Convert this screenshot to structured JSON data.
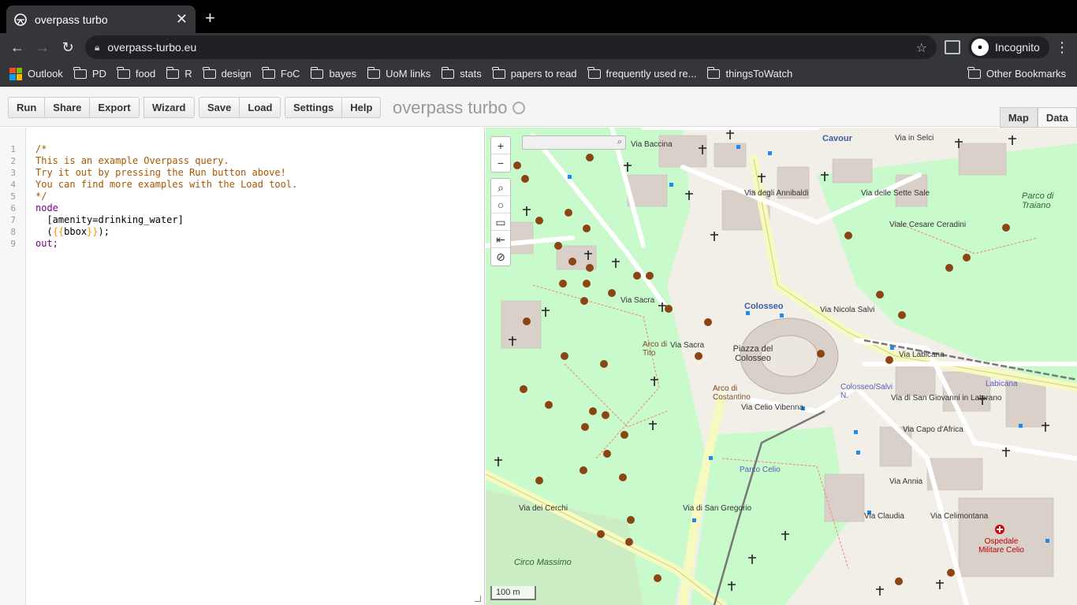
{
  "browser": {
    "tab_title": "overpass turbo",
    "url": "overpass-turbo.eu",
    "profile_label": "Incognito",
    "bookmarks": [
      "Outlook",
      "PD",
      "food",
      "R",
      "design",
      "FoC",
      "bayes",
      "UoM links",
      "stats",
      "papers to read",
      "frequently used re...",
      "thingsToWatch"
    ],
    "other_bookmarks": "Other Bookmarks"
  },
  "app": {
    "buttons": {
      "run": "Run",
      "share": "Share",
      "export": "Export",
      "wizard": "Wizard",
      "save": "Save",
      "load": "Load",
      "settings": "Settings",
      "help": "Help"
    },
    "brand": "overpass turbo",
    "view_tabs": {
      "map": "Map",
      "data": "Data"
    }
  },
  "editor": {
    "line_numbers": [
      "1",
      "2",
      "3",
      "4",
      "5",
      "6",
      "7",
      "8",
      "9"
    ],
    "lines": [
      "/*",
      "This is an example Overpass query.",
      "Try it out by pressing the Run button above!",
      "You can find more examples with the Load tool.",
      "*/",
      "node",
      "  [amenity=drinking_water]",
      "  ({{bbox}});",
      "out;"
    ]
  },
  "map": {
    "labels": {
      "cavour": "Cavour",
      "via_in_selci": "Via in Selci",
      "via_baccina": "Via Baccina",
      "via_degli_annibaldi": "Via degli Annibaldi",
      "via_delle_sette_sale": "Via delle Sette Sale",
      "parco_di_traiano": "Parco di Traiano",
      "via_cesare_ceradini": "Viale Cesare Ceradini",
      "colosseo": "Colosseo",
      "via_nicola_salvi": "Via Nicola Salvi",
      "piazza_del_colosseo": "Piazza del Colosseo",
      "via_sacra": "Via Sacra",
      "arco_di_tito": "Arco di Tito",
      "arco_di_costantino": "Arco di Costantino",
      "via_celio_vibenna": "Via Celio Vibenna",
      "via_labicana": "Via Labicana",
      "labicana": "Labicana",
      "colosseo_salvi": "Colosseo/Salvi N.",
      "via_s_giovanni": "Via di San Giovanni in Laterano",
      "via_capo_d_africa": "Via Capo d'Africa",
      "parco_celio": "Parco Celio",
      "via_annia": "Via Annia",
      "via_dei_cerchi": "Via dei Cerchi",
      "via_di_san_gregorio": "Via di San Gregorio",
      "circo_massimo": "Circo Massimo",
      "ospedale_militare_celio": "Ospedale Militare Celio",
      "via_claudia": "Via Claudia",
      "via_celimontana": "Via Celimontana",
      "via_sacra_2": "Via Sacra"
    },
    "scale": "100 m",
    "search_placeholder": ""
  },
  "colors": {
    "tab_bg": "#35363a",
    "park": "#c8facc",
    "road_major": "#f7fabf",
    "road_minor": "#ffffff",
    "building": "#d9d0c9",
    "marker": "#8b4513",
    "rail": "#777777"
  }
}
